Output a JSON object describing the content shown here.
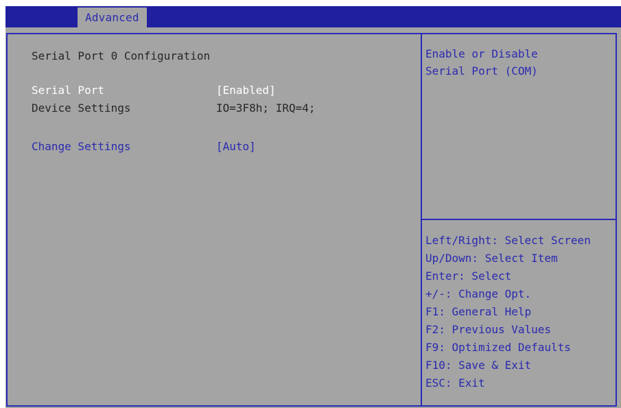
{
  "tab": {
    "label": "Advanced"
  },
  "section": {
    "title": "Serial Port 0 Configuration"
  },
  "settings": [
    {
      "label": "Serial Port",
      "value": "[Enabled]"
    },
    {
      "label": "Device Settings",
      "value": "IO=3F8h; IRQ=4;"
    },
    {
      "label": "Change Settings",
      "value": "[Auto]"
    }
  ],
  "help": {
    "lines": [
      "Enable or Disable",
      "Serial Port (COM)"
    ]
  },
  "keys": [
    "Left/Right: Select Screen",
    "Up/Down: Select Item",
    "Enter: Select",
    "+/-: Change Opt.",
    "F1: General Help",
    "F2: Previous Values",
    "F9: Optimized Defaults",
    "F10: Save & Exit",
    "ESC: Exit"
  ],
  "colors": {
    "background": "#a4a4a4",
    "accent": "#1f1fa0",
    "selected_text": "#ffffff",
    "text": "#262626"
  }
}
